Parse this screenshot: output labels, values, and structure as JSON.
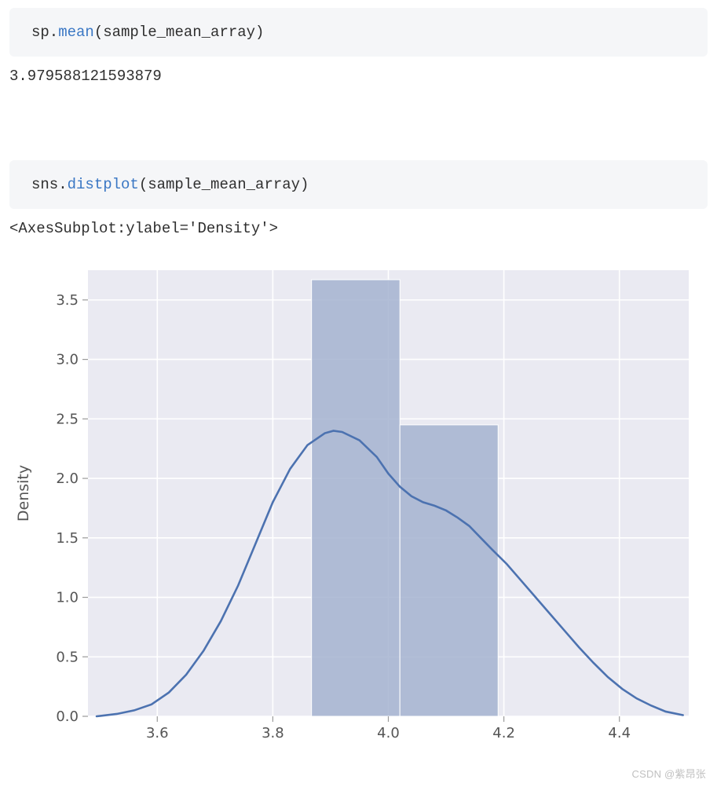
{
  "cells": [
    {
      "code_prefix": "sp.",
      "code_func": "mean",
      "code_suffix": "(sample_mean_array)",
      "output": "3.979588121593879"
    },
    {
      "code_prefix": "sns.",
      "code_func": "distplot",
      "code_suffix": "(sample_mean_array)",
      "output": "<AxesSubplot:ylabel='Density'>"
    }
  ],
  "chart_data": {
    "type": "bar",
    "ylabel": "Density",
    "x_ticks": [
      3.6,
      3.8,
      4.0,
      4.2,
      4.4
    ],
    "y_ticks": [
      0.0,
      0.5,
      1.0,
      1.5,
      2.0,
      2.5,
      3.0,
      3.5
    ],
    "ylim": [
      0.0,
      3.75
    ],
    "xlim": [
      3.48,
      4.52
    ],
    "bars": [
      {
        "x_start": 3.867,
        "x_end": 4.02,
        "height": 3.67
      },
      {
        "x_start": 4.02,
        "x_end": 4.19,
        "height": 2.45
      }
    ],
    "kde_line": [
      [
        3.495,
        0.0
      ],
      [
        3.53,
        0.02
      ],
      [
        3.56,
        0.05
      ],
      [
        3.59,
        0.1
      ],
      [
        3.62,
        0.2
      ],
      [
        3.65,
        0.35
      ],
      [
        3.68,
        0.55
      ],
      [
        3.71,
        0.8
      ],
      [
        3.74,
        1.1
      ],
      [
        3.77,
        1.45
      ],
      [
        3.8,
        1.8
      ],
      [
        3.83,
        2.08
      ],
      [
        3.86,
        2.28
      ],
      [
        3.89,
        2.38
      ],
      [
        3.905,
        2.4
      ],
      [
        3.92,
        2.39
      ],
      [
        3.95,
        2.32
      ],
      [
        3.98,
        2.18
      ],
      [
        4.0,
        2.04
      ],
      [
        4.02,
        1.93
      ],
      [
        4.04,
        1.85
      ],
      [
        4.06,
        1.8
      ],
      [
        4.08,
        1.77
      ],
      [
        4.1,
        1.73
      ],
      [
        4.12,
        1.67
      ],
      [
        4.14,
        1.6
      ],
      [
        4.16,
        1.5
      ],
      [
        4.18,
        1.4
      ],
      [
        4.205,
        1.28
      ],
      [
        4.23,
        1.14
      ],
      [
        4.255,
        1.0
      ],
      [
        4.28,
        0.86
      ],
      [
        4.305,
        0.72
      ],
      [
        4.33,
        0.58
      ],
      [
        4.355,
        0.45
      ],
      [
        4.38,
        0.33
      ],
      [
        4.405,
        0.23
      ],
      [
        4.43,
        0.15
      ],
      [
        4.455,
        0.09
      ],
      [
        4.48,
        0.04
      ],
      [
        4.51,
        0.01
      ]
    ]
  },
  "watermark": "CSDN @紫昂张"
}
